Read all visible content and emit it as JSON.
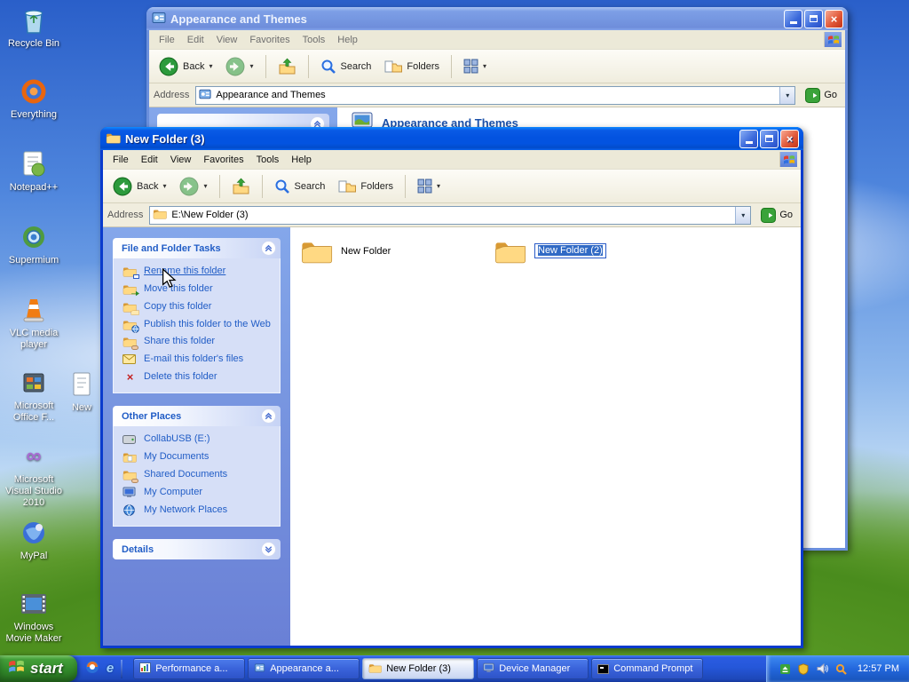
{
  "glyphs": {
    "close": "×",
    "dropdown": "▾",
    "delete_x": "×",
    "ie_e": "e",
    "vs_infinity": "∞"
  },
  "colors": {
    "titlebar_active": "#0353e0",
    "titlebar_inactive": "#7d9fe6",
    "task_link": "#215dc6",
    "selection": "#316ac5",
    "taskbar_blue": "#2557d9",
    "start_green": "#31892a"
  },
  "desktop": {
    "icons": [
      {
        "name": "recycle-bin",
        "label": "Recycle Bin"
      },
      {
        "name": "everything",
        "label": "Everything"
      },
      {
        "name": "notepad-plus-plus",
        "label": "Notepad++"
      },
      {
        "name": "supermium",
        "label": "Supermium"
      },
      {
        "name": "vlc-media-player",
        "label": "VLC media player"
      },
      {
        "name": "microsoft-office",
        "label": "Microsoft Office F..."
      },
      {
        "name": "microsoft-visual-studio-2010",
        "label": "Microsoft Visual Studio 2010"
      },
      {
        "name": "mypal",
        "label": "MyPal"
      },
      {
        "name": "windows-movie-maker",
        "label": "Windows Movie Maker"
      },
      {
        "name": "new-item-partial",
        "label": "New"
      }
    ]
  },
  "bg_window": {
    "title": "Appearance and Themes",
    "menu": [
      "File",
      "Edit",
      "View",
      "Favorites",
      "Tools",
      "Help"
    ],
    "toolbar": {
      "back": "Back",
      "search": "Search",
      "folders": "Folders"
    },
    "address_label": "Address",
    "address_value": "Appearance and Themes",
    "go_label": "Go",
    "content_title": "Appearance and Themes"
  },
  "fg_window": {
    "title": "New Folder (3)",
    "menu": [
      "File",
      "Edit",
      "View",
      "Favorites",
      "Tools",
      "Help"
    ],
    "toolbar": {
      "back": "Back",
      "search": "Search",
      "folders": "Folders"
    },
    "address_label": "Address",
    "address_value": "E:\\New Folder (3)",
    "go_label": "Go",
    "file_tasks": {
      "title": "File and Folder Tasks",
      "items": [
        {
          "icon": "rename-folder-icon",
          "label": "Rename this folder"
        },
        {
          "icon": "move-folder-icon",
          "label": "Move this folder"
        },
        {
          "icon": "copy-folder-icon",
          "label": "Copy this folder"
        },
        {
          "icon": "publish-folder-icon",
          "label": "Publish this folder to the Web"
        },
        {
          "icon": "share-folder-icon",
          "label": "Share this folder"
        },
        {
          "icon": "email-files-icon",
          "label": "E-mail this folder's files"
        },
        {
          "icon": "delete-folder-icon",
          "label": "Delete this folder"
        }
      ]
    },
    "other_places": {
      "title": "Other Places",
      "items": [
        {
          "icon": "drive-icon",
          "label": "CollabUSB (E:)"
        },
        {
          "icon": "my-documents-icon",
          "label": "My Documents"
        },
        {
          "icon": "shared-documents-icon",
          "label": "Shared Documents"
        },
        {
          "icon": "my-computer-icon",
          "label": "My Computer"
        },
        {
          "icon": "network-places-icon",
          "label": "My Network Places"
        }
      ]
    },
    "details": {
      "title": "Details"
    },
    "files": [
      {
        "label": "New Folder",
        "renaming": false
      },
      {
        "label": "New Folder (2)",
        "renaming": true
      }
    ]
  },
  "taskbar": {
    "start_label": "start",
    "buttons": [
      {
        "icon": "performance-chart-icon",
        "label": "Performance a...",
        "active": false
      },
      {
        "icon": "control-panel-icon",
        "label": "Appearance a...",
        "active": false
      },
      {
        "icon": "folder-icon",
        "label": "New Folder (3)",
        "active": true
      },
      {
        "icon": "device-manager-icon",
        "label": "Device Manager",
        "active": false
      },
      {
        "icon": "command-prompt-icon",
        "label": "Command Prompt",
        "active": false
      }
    ],
    "tray_icons": [
      "tray-eject-icon",
      "tray-shield-icon",
      "tray-volume-icon",
      "tray-search-icon"
    ],
    "clock": "12:57 PM"
  }
}
